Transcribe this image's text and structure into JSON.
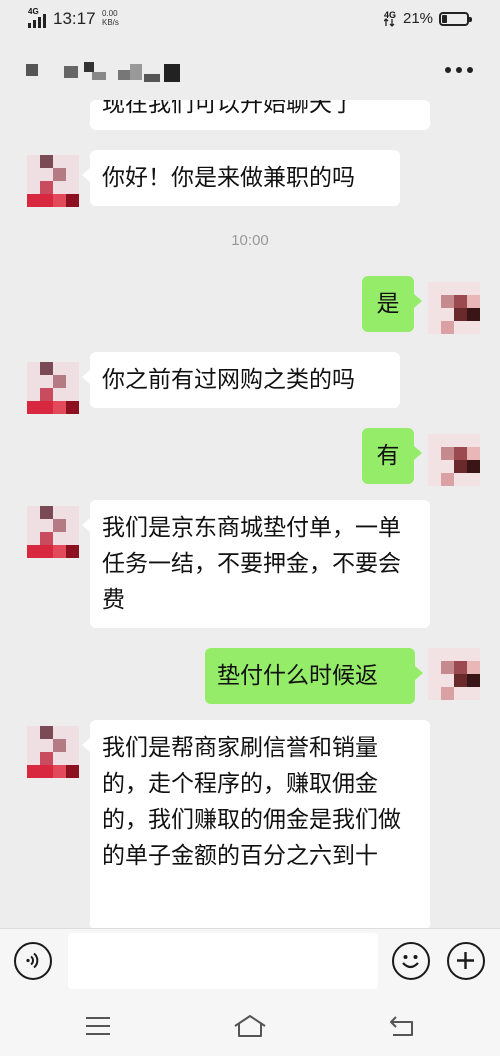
{
  "status_bar": {
    "network_left": "4G",
    "time": "13:17",
    "speed_value": "0.00",
    "speed_unit": "KB/s",
    "network_right": "4G",
    "battery_percent": "21%",
    "battery_level": 0.21
  },
  "title_bar": {
    "more_icon": "more-dots-icon"
  },
  "chat": {
    "timestamp": "10:00",
    "messages": [
      {
        "from": "them",
        "text": "现在我们可以开始聊天了"
      },
      {
        "from": "them",
        "text": "你好！你是来做兼职的吗"
      },
      {
        "from": "me",
        "text": "是"
      },
      {
        "from": "them",
        "text": "你之前有过网购之类的吗"
      },
      {
        "from": "me",
        "text": "有"
      },
      {
        "from": "them",
        "text": "我们是京东商城垫付单，一单任务一结，不要押金，不要会费"
      },
      {
        "from": "me",
        "text": "垫付什么时候返"
      },
      {
        "from": "them",
        "text": "我们是帮商家刷信誉和销量的，走个程序的，赚取佣金的，我们赚取的佣金是我们做的单子金额的百分之六到十"
      }
    ]
  },
  "input_bar": {
    "voice_icon": "voice-icon",
    "emoji_icon": "emoji-icon",
    "plus_icon": "plus-icon",
    "input_value": ""
  },
  "nav_bar": {
    "menu_icon": "menu-icon",
    "home_icon": "home-icon",
    "back_icon": "back-icon"
  },
  "colors": {
    "background": "#ededed",
    "incoming_bubble": "#ffffff",
    "outgoing_bubble": "#95ec69"
  }
}
